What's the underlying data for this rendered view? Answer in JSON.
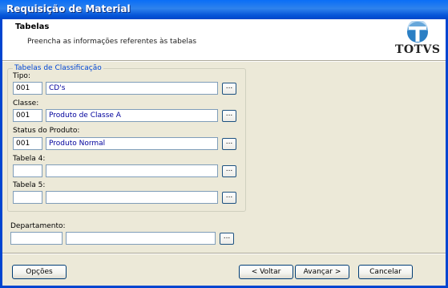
{
  "window": {
    "title": "Requisição de Material"
  },
  "header": {
    "title": "Tabelas",
    "subtitle": "Preencha as informações referentes às tabelas",
    "logo_text": "TOTVS"
  },
  "group": {
    "legend": "Tabelas de Classificação"
  },
  "fields": {
    "tipo": {
      "label": "Tipo:",
      "code": "001",
      "desc": "CD's"
    },
    "classe": {
      "label": "Classe:",
      "code": "001",
      "desc": "Produto de Classe A"
    },
    "status": {
      "label": "Status do Produto:",
      "code": "001",
      "desc": "Produto Normal"
    },
    "tabela4": {
      "label": "Tabela 4:",
      "code": "",
      "desc": ""
    },
    "tabela5": {
      "label": "Tabela 5:",
      "code": "",
      "desc": ""
    },
    "departamento": {
      "label": "Departamento:",
      "code": "",
      "desc": ""
    }
  },
  "lookup_label": "...",
  "buttons": {
    "options": "Opções",
    "back": "< Voltar",
    "next": "Avançar >",
    "cancel": "Cancelar"
  },
  "icons": {
    "logo": "totvs-logo-icon"
  },
  "colors": {
    "title_bar": "#0a5fe8",
    "accent": "#0046d5",
    "desc_text": "#00009c"
  }
}
